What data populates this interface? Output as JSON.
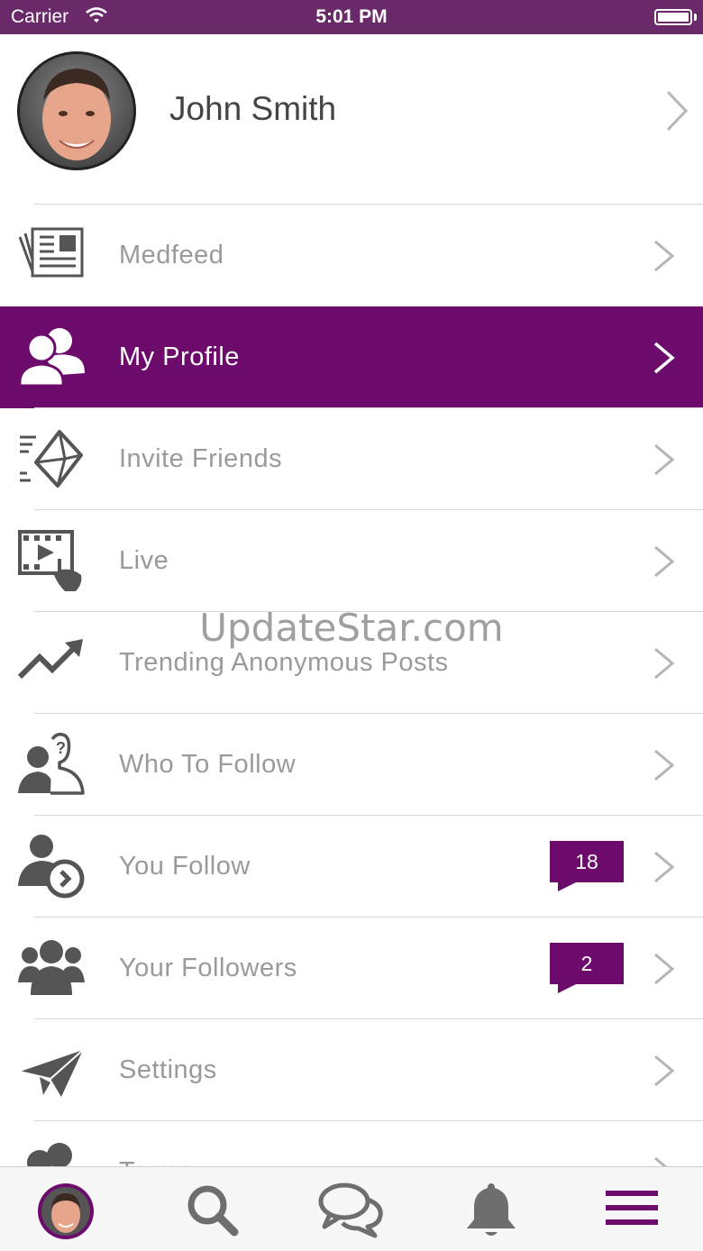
{
  "status_bar": {
    "carrier": "Carrier",
    "time": "5:01 PM"
  },
  "profile": {
    "name": "John Smith"
  },
  "menu": {
    "items": [
      {
        "label": "Medfeed",
        "icon": "newspaper-icon"
      },
      {
        "label": "My Profile",
        "icon": "profile-users-icon",
        "active": true
      },
      {
        "label": "Invite Friends",
        "icon": "envelope-icon"
      },
      {
        "label": "Live",
        "icon": "video-touch-icon"
      },
      {
        "label": "Trending Anonymous Posts",
        "icon": "trending-icon"
      },
      {
        "label": "Who To Follow",
        "icon": "user-question-icon"
      },
      {
        "label": "You Follow",
        "icon": "user-arrow-icon",
        "badge": "18"
      },
      {
        "label": "Your Followers",
        "icon": "group-icon",
        "badge": "2"
      },
      {
        "label": "Settings",
        "icon": "paper-plane-icon"
      },
      {
        "label": "Terms",
        "icon": "terms-icon"
      }
    ]
  },
  "watermark": "UpdateStar.com",
  "tab_bar": {
    "tabs": [
      {
        "name": "profile-avatar-tab"
      },
      {
        "name": "search-tab"
      },
      {
        "name": "messages-tab"
      },
      {
        "name": "notifications-tab"
      },
      {
        "name": "menu-tab",
        "active": true
      }
    ]
  },
  "colors": {
    "accent": "#6c0b6c",
    "status_bar": "#6a2a6a",
    "text_muted": "#9a9a9a",
    "icon_gray": "#666666"
  }
}
